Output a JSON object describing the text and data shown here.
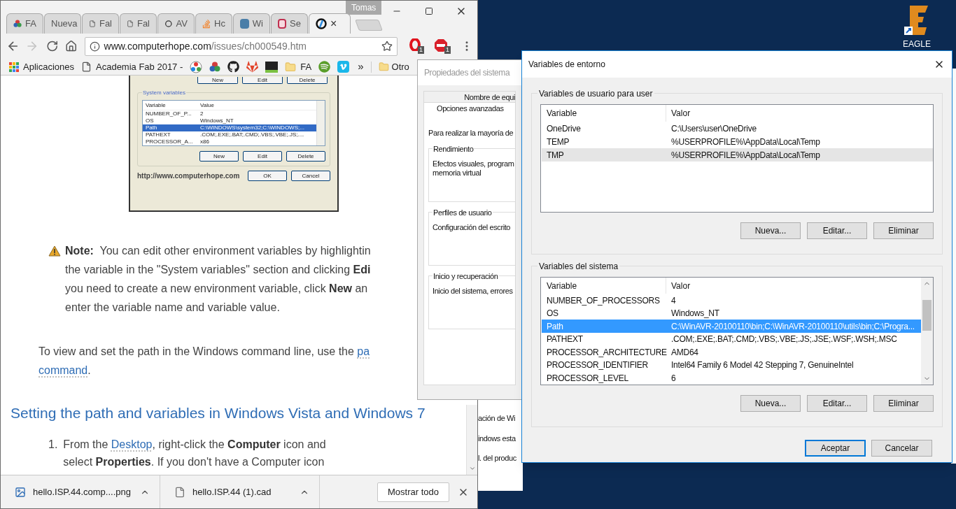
{
  "desktop": {
    "icons": [
      {
        "label": "EAGLE"
      }
    ]
  },
  "browser": {
    "profile": "Tomas",
    "tabs": [
      {
        "kind": "fab",
        "label": "FA",
        "selected": false
      },
      {
        "kind": "none",
        "label": "Nueva",
        "selected": false
      },
      {
        "kind": "page",
        "label": "Fal",
        "selected": false
      },
      {
        "kind": "page",
        "label": "Fal",
        "selected": false
      },
      {
        "kind": "ring",
        "label": "AV",
        "selected": false
      },
      {
        "kind": "stack",
        "label": "Hc",
        "selected": false
      },
      {
        "kind": "sf",
        "label": "Wi",
        "selected": false
      },
      {
        "kind": "red",
        "label": "Se",
        "selected": false
      },
      {
        "kind": "blue",
        "close": "×",
        "selected": true
      }
    ],
    "address": {
      "domain": "www.computerhope.com",
      "path": "/issues/ch000549.htm"
    },
    "extension_badges": [
      "1",
      "1"
    ],
    "bookmarks": [
      {
        "kind": "apps",
        "label": "Aplicaciones"
      },
      {
        "kind": "page",
        "label": "Academia Fab 2017 -"
      },
      {
        "kind": "fablab"
      },
      {
        "kind": "colors"
      },
      {
        "kind": "github"
      },
      {
        "kind": "gitlab"
      },
      {
        "kind": "vnc"
      },
      {
        "kind": "folder",
        "label": "FA"
      },
      {
        "kind": "spotify"
      },
      {
        "kind": "vimeo"
      }
    ],
    "bookmarks_overflow": "»",
    "other_bookmarks": "Otro",
    "article": {
      "figure": {
        "top_buttons": [
          "New",
          "Edit",
          "Delete"
        ],
        "group": "System variables",
        "columns": [
          "Variable",
          "Value"
        ],
        "rows": [
          {
            "cells": [
              "NUMBER_OF_P...",
              "2"
            ],
            "selected": false
          },
          {
            "cells": [
              "OS",
              "Windows_NT"
            ],
            "selected": false
          },
          {
            "cells": [
              "Path",
              "C:\\WINDOWS\\system32;C:\\WINDOWS;..."
            ],
            "selected": true
          },
          {
            "cells": [
              "PATHEXT",
              ".COM;.EXE;.BAT;.CMD;.VBS;.VBE;.JS;...."
            ],
            "selected": false
          },
          {
            "cells": [
              "PROCESSOR_A...",
              "x86"
            ],
            "selected": false
          }
        ],
        "buttons": [
          "New",
          "Edit",
          "Delete"
        ],
        "ok": "OK",
        "cancel": "Cancel",
        "url": "http://www.computerhope.com"
      },
      "note": [
        [
          {
            "kind": "bold",
            "text": "Note:"
          },
          {
            "kind": "text",
            "text": "  You can edit other environment variables by highlightin"
          }
        ],
        [
          {
            "kind": "text",
            "text": "the variable in the \"System variables\" section and clicking "
          },
          {
            "kind": "bold",
            "text": "Edi"
          }
        ],
        [
          {
            "kind": "text",
            "text": "you need to create a new environment variable, click "
          },
          {
            "kind": "bold",
            "text": "New"
          },
          {
            "kind": "text",
            "text": " an"
          }
        ],
        [
          {
            "kind": "text",
            "text": "enter the variable name and variable value."
          }
        ]
      ],
      "paragraph": [
        [
          {
            "kind": "text",
            "text": "To view and set the path in the Windows command line, use the "
          },
          {
            "kind": "link",
            "text": "pa"
          }
        ],
        [
          {
            "kind": "link",
            "text": "command"
          },
          {
            "kind": "text",
            "text": "."
          }
        ]
      ],
      "heading": "Setting the path and variables in Windows Vista and Windows 7",
      "steps": [
        {
          "number": "1.",
          "lines": [
            [
              {
                "kind": "text",
                "text": "From the "
              },
              {
                "kind": "link",
                "text": "Desktop"
              },
              {
                "kind": "text",
                "text": ", right-click the "
              },
              {
                "kind": "bold",
                "text": "Computer"
              },
              {
                "kind": "text",
                "text": " icon and"
              }
            ],
            [
              {
                "kind": "text",
                "text": "select "
              },
              {
                "kind": "bold",
                "text": "Properties"
              },
              {
                "kind": "text",
                "text": ". If you don't have a Computer icon"
              }
            ]
          ]
        }
      ]
    },
    "downloads": {
      "items": [
        {
          "kind": "image",
          "name": "hello.ISP.44.comp....png"
        },
        {
          "kind": "file",
          "name": "hello.ISP.44 (1).cad"
        }
      ],
      "show_all": "Mostrar todo"
    }
  },
  "behind_window": {
    "lines": [
      "ación de Wi",
      "indows esta",
      "l. del produc"
    ]
  },
  "system_properties": {
    "title": "Propiedades del sistema",
    "tab": "Nombre de equi",
    "subtab": "Opciones avanzadas",
    "intro": "Para realizar la mayoría de",
    "groups": [
      {
        "title": "Rendimiento",
        "lines": [
          "Efectos visuales, program",
          "memoria virtual"
        ]
      },
      {
        "title": "Perfiles de usuario",
        "lines": [
          "Configuración del escrito"
        ]
      },
      {
        "title": "Inicio y recuperación",
        "lines": [
          "Inicio del sistema, errores"
        ]
      }
    ]
  },
  "environment": {
    "title": "Variables de entorno",
    "groups": [
      {
        "title": "Variables de usuario para user",
        "columns": [
          "Variable",
          "Valor"
        ],
        "scrollbar": false,
        "rows": [
          {
            "cells": [
              "OneDrive",
              "C:\\Users\\user\\OneDrive"
            ],
            "selected": false
          },
          {
            "cells": [
              "TEMP",
              "%USERPROFILE%\\AppData\\Local\\Temp"
            ],
            "selected": false
          },
          {
            "cells": [
              "TMP",
              "%USERPROFILE%\\AppData\\Local\\Temp"
            ],
            "selected": true
          }
        ],
        "buttons": [
          "Nueva...",
          "Editar...",
          "Eliminar"
        ]
      },
      {
        "title": "Variables del sistema",
        "columns": [
          "Variable",
          "Valor"
        ],
        "scrollbar": true,
        "rows": [
          {
            "cells": [
              "NUMBER_OF_PROCESSORS",
              "4"
            ],
            "selected": false
          },
          {
            "cells": [
              "OS",
              "Windows_NT"
            ],
            "selected": false
          },
          {
            "cells": [
              "Path",
              "C:\\WinAVR-20100110\\bin;C:\\WinAVR-20100110\\utils\\bin;C:\\Progra..."
            ],
            "selected": true
          },
          {
            "cells": [
              "PATHEXT",
              ".COM;.EXE;.BAT;.CMD;.VBS;.VBE;.JS;.JSE;.WSF;.WSH;.MSC"
            ],
            "selected": false
          },
          {
            "cells": [
              "PROCESSOR_ARCHITECTURE",
              "AMD64"
            ],
            "selected": false
          },
          {
            "cells": [
              "PROCESSOR_IDENTIFIER",
              "Intel64 Family 6 Model 42 Stepping 7, GenuineIntel"
            ],
            "selected": false
          },
          {
            "cells": [
              "PROCESSOR_LEVEL",
              "6"
            ],
            "selected": false
          }
        ],
        "buttons": [
          "Nueva...",
          "Editar...",
          "Eliminar"
        ]
      }
    ],
    "ok": "Aceptar",
    "cancel": "Cancelar"
  }
}
